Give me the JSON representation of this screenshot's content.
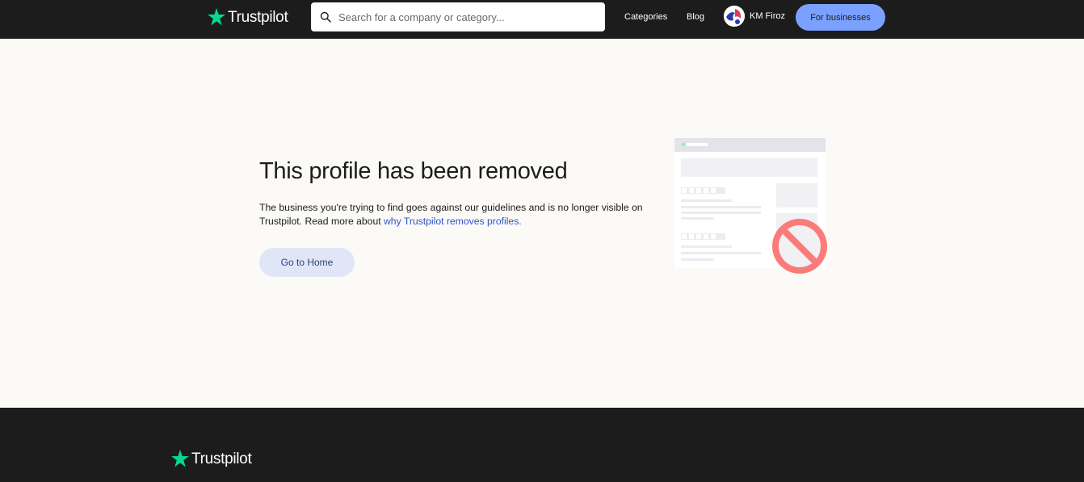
{
  "header": {
    "brand": "Trustpilot",
    "search": {
      "placeholder": "Search for a company or category..."
    },
    "nav": {
      "categories": "Categories",
      "blog": "Blog"
    },
    "user": {
      "name": "KM Firoz"
    },
    "for_businesses": "For businesses"
  },
  "main": {
    "title": "This profile has been removed",
    "description_prefix": "The business you're trying to find goes against our guidelines and is no longer visible on Trustpilot. Read more about ",
    "description_link": "why Trustpilot removes profiles.",
    "home_button": "Go to Home"
  },
  "footer": {
    "brand": "Trustpilot"
  },
  "colors": {
    "header_bg": "#1c1c1c",
    "brand_green": "#04da8d",
    "page_bg": "#fbfaf7",
    "accent_blue": "#7aa1ff",
    "link_blue": "#2f52cc",
    "home_button_bg": "#e1e6f7",
    "prohibited_red": "#fb7b7b"
  },
  "icons": {
    "logo": "star-icon",
    "search": "search-icon",
    "removed": "prohibited-icon"
  }
}
